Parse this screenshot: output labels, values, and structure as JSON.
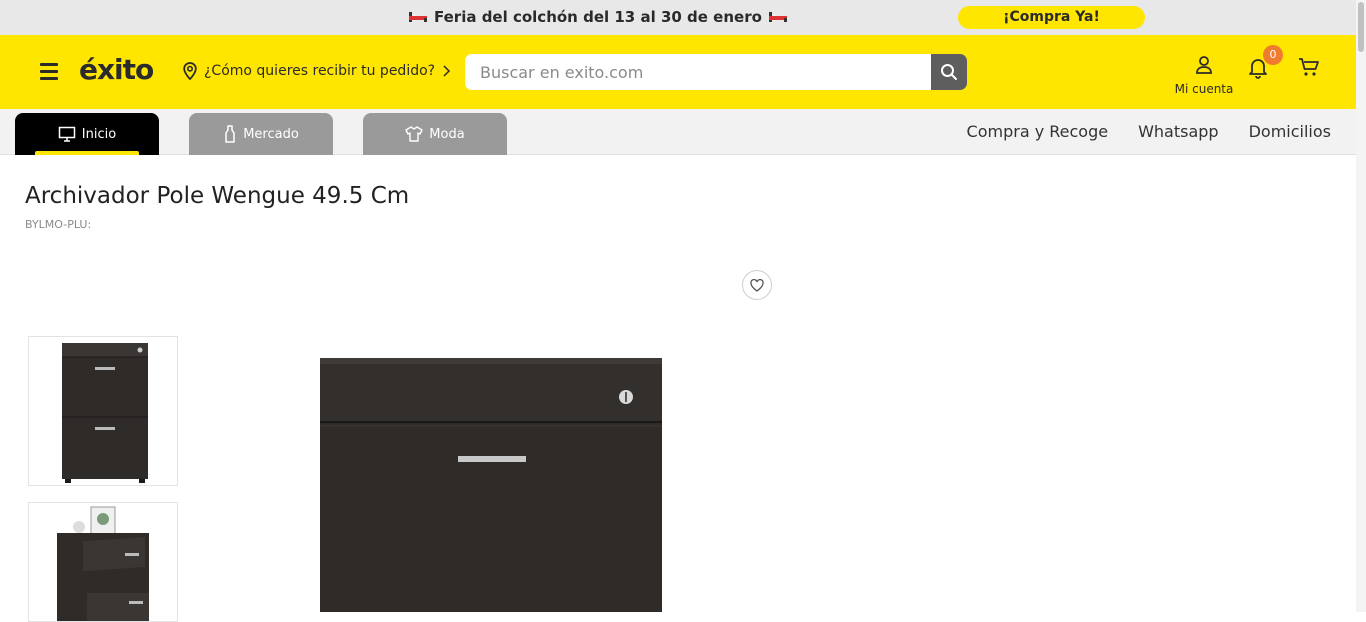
{
  "promo": {
    "text": "Feria del colchón del 13 al 30 de enero",
    "cta": "¡Compra Ya!",
    "icon": "bed-icon"
  },
  "header": {
    "logo": "éxito",
    "location_prompt": "¿Cómo quieres recibir tu pedido?",
    "search_placeholder": "Buscar en exito.com",
    "account_label": "Mi cuenta",
    "notifications_count": "0"
  },
  "nav": {
    "tabs": [
      {
        "label": "Inicio",
        "icon": "monitor-icon",
        "active": true
      },
      {
        "label": "Mercado",
        "icon": "bottle-icon",
        "active": false
      },
      {
        "label": "Moda",
        "icon": "shirt-icon",
        "active": false
      }
    ],
    "links": [
      "Compra y Recoge",
      "Whatsapp",
      "Domicilios"
    ]
  },
  "product": {
    "title": "Archivador Pole Wengue 49.5 Cm",
    "sku": "BYLMO-PLU:"
  },
  "colors": {
    "brand_yellow": "#ffe600",
    "badge_orange": "#f07b2f",
    "tab_inactive": "#9a9a9a",
    "product_wood": "#2e2b29"
  }
}
